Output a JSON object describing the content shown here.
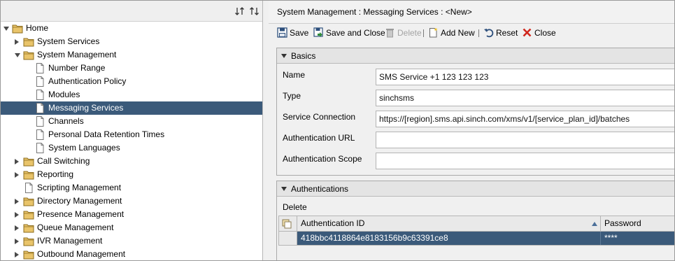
{
  "tree": {
    "nodes": [
      {
        "label": "Home",
        "icon": "folder-icon",
        "toggle": "open"
      },
      {
        "label": "System Services",
        "icon": "folder-icon",
        "toggle": "closed"
      },
      {
        "label": "System Management",
        "icon": "folder-icon",
        "toggle": "open"
      },
      {
        "label": "Number Range",
        "icon": "document-icon",
        "toggle": "none"
      },
      {
        "label": "Authentication Policy",
        "icon": "document-icon",
        "toggle": "none"
      },
      {
        "label": "Modules",
        "icon": "document-icon",
        "toggle": "none"
      },
      {
        "label": "Messaging Services",
        "icon": "document-icon",
        "toggle": "none",
        "selected": true
      },
      {
        "label": "Channels",
        "icon": "document-icon",
        "toggle": "none"
      },
      {
        "label": "Personal Data Retention Times",
        "icon": "document-icon",
        "toggle": "none"
      },
      {
        "label": "System Languages",
        "icon": "document-icon",
        "toggle": "none"
      },
      {
        "label": "Call Switching",
        "icon": "folder-icon",
        "toggle": "closed"
      },
      {
        "label": "Reporting",
        "icon": "folder-icon",
        "toggle": "closed"
      },
      {
        "label": "Scripting Management",
        "icon": "document-icon",
        "toggle": "none"
      },
      {
        "label": "Directory Management",
        "icon": "folder-icon",
        "toggle": "closed"
      },
      {
        "label": "Presence Management",
        "icon": "folder-icon",
        "toggle": "closed"
      },
      {
        "label": "Queue Management",
        "icon": "folder-icon",
        "toggle": "closed"
      },
      {
        "label": "IVR Management",
        "icon": "folder-icon",
        "toggle": "closed"
      },
      {
        "label": "Outbound Management",
        "icon": "folder-icon",
        "toggle": "closed"
      }
    ]
  },
  "header": {
    "title": "System Management : Messaging Services : <New>"
  },
  "toolbar": {
    "save": "Save",
    "save_close": "Save and Close",
    "delete": "Delete",
    "add_new": "Add New",
    "reset": "Reset",
    "close": "Close"
  },
  "basics": {
    "title": "Basics",
    "name_label": "Name",
    "name_value": "SMS Service +1 123 123 123",
    "type_label": "Type",
    "type_value": "sinchsms",
    "connection_label": "Service Connection",
    "connection_value": "https://[region].sms.api.sinch.com/xms/v1/[service_plan_id]/batches",
    "auth_url_label": "Authentication URL",
    "auth_url_value": "",
    "auth_scope_label": "Authentication Scope",
    "auth_scope_value": ""
  },
  "authentications": {
    "title": "Authentications",
    "delete_label": "Delete",
    "columns": [
      "Authentication ID",
      "Password"
    ],
    "rows": [
      {
        "id": "418bbc4118864e8183156b9c63391ce8",
        "password": "****"
      }
    ]
  },
  "colors": {
    "selection": "#3b5a7a",
    "folder": "#c99a3c"
  }
}
